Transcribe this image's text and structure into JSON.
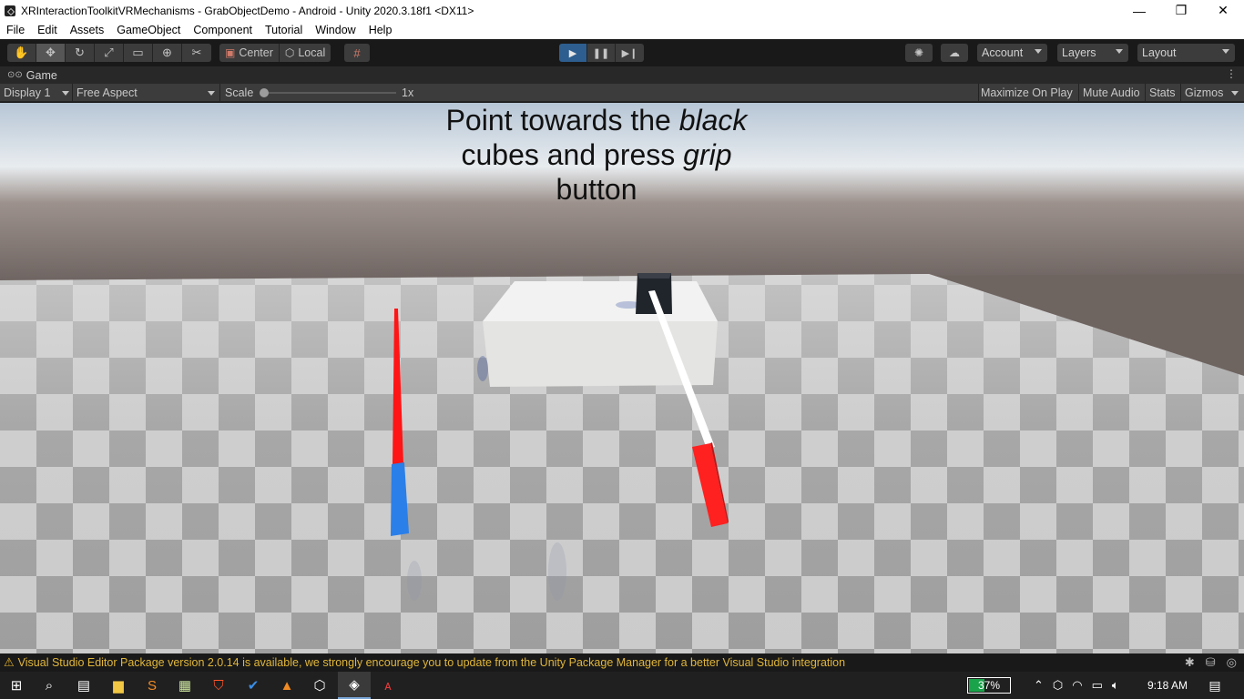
{
  "window": {
    "title": "XRInteractionToolkitVRMechanisms - GrabObjectDemo - Android - Unity 2020.3.18f1 <DX11>",
    "minimize": "—",
    "maximize": "❐",
    "close": "✕"
  },
  "menu": [
    "File",
    "Edit",
    "Assets",
    "GameObject",
    "Component",
    "Tutorial",
    "Window",
    "Help"
  ],
  "toolbar": {
    "tools": [
      "hand-icon",
      "move-icon",
      "rotate-icon",
      "scale-icon",
      "rect-tool-icon",
      "transform-icon",
      "custom-tool-icon"
    ],
    "pivot_mode": "Center",
    "pivot_rotation": "Local",
    "snap_icon": "grid-snap-icon",
    "play_state": "playing",
    "account": "Account",
    "layers": "Layers",
    "layout": "Layout"
  },
  "game_tab": {
    "label": "Game"
  },
  "game_controls": {
    "display": "Display 1",
    "aspect": "Free Aspect",
    "scale_label": "Scale",
    "scale_value": "1x",
    "maximize_on_play": "Maximize On Play",
    "mute_audio": "Mute Audio",
    "stats": "Stats",
    "gizmos": "Gizmos"
  },
  "scene": {
    "instruction_line1_a": "Point towards the ",
    "instruction_line1_b": "black",
    "instruction_line2_a": "cubes and press ",
    "instruction_line2_b": "grip",
    "instruction_line3": "button",
    "colors": {
      "sky_top": "#b8c7d8",
      "horizon": "#7a6f6b",
      "floor_light": "#c9c9c9",
      "floor_dark": "#9b9b9b",
      "controller_red": "#ff1f1f",
      "controller_blue": "#2d7fe6",
      "ray": "#ffffff",
      "cube": "#22262d",
      "table": "#e9e9e9"
    }
  },
  "status": {
    "message": "Visual Studio Editor Package version 2.0.14 is available, we strongly encourage you to update from the Unity Package Manager for a better Visual Studio integration"
  },
  "taskbar": {
    "battery": "37%",
    "battery_level": 0.37,
    "time": "9:18 AM"
  }
}
